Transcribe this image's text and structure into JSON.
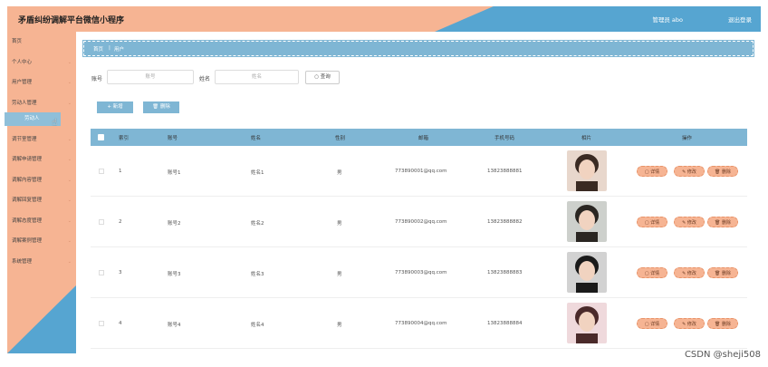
{
  "header": {
    "title": "矛盾纠纷调解平台微信小程序",
    "user": "管理员 abo",
    "logout": "退出登录"
  },
  "sidebar": {
    "items": [
      {
        "label": "首页",
        "chevron": false
      },
      {
        "label": "个人中心",
        "chevron": true
      },
      {
        "label": "用户管理",
        "chevron": true
      },
      {
        "label": "劳动人管理",
        "chevron": true
      },
      {
        "label": "调节室管理",
        "chevron": true
      },
      {
        "label": "调解申请管理",
        "chevron": true
      },
      {
        "label": "调解内容管理",
        "chevron": true
      },
      {
        "label": "调解回复管理",
        "chevron": true
      },
      {
        "label": "调解态度管理",
        "chevron": true
      },
      {
        "label": "调解案例管理",
        "chevron": true
      },
      {
        "label": "系统管理",
        "chevron": true
      }
    ],
    "submenu_item": "劳动人"
  },
  "breadcrumb": {
    "home": "首页",
    "current": "用户"
  },
  "search": {
    "account_label": "账号",
    "account_placeholder": "账号",
    "name_label": "姓名",
    "name_placeholder": "姓名",
    "button": "查询"
  },
  "actions": {
    "add": "新增",
    "delete": "删除"
  },
  "table": {
    "headers": [
      "索引",
      "账号",
      "姓名",
      "性别",
      "邮箱",
      "手机号码",
      "相片",
      "操作"
    ],
    "rows": [
      {
        "index": "1",
        "account": "账号1",
        "name": "姓名1",
        "gender": "男",
        "email": "773890001@qq.com",
        "phone": "13823888881"
      },
      {
        "index": "2",
        "account": "账号2",
        "name": "姓名2",
        "gender": "男",
        "email": "773890002@qq.com",
        "phone": "13823888882"
      },
      {
        "index": "3",
        "account": "账号3",
        "name": "姓名3",
        "gender": "男",
        "email": "773890003@qq.com",
        "phone": "13823888883"
      },
      {
        "index": "4",
        "account": "账号4",
        "name": "姓名4",
        "gender": "男",
        "email": "773890004@qq.com",
        "phone": "13823888884"
      }
    ],
    "row_actions": {
      "detail": "详情",
      "edit": "修改",
      "delete": "删除"
    }
  },
  "watermark": "CSDN @sheji508",
  "colors": {
    "peach": "#f6b493",
    "blue": "#56a5d1",
    "light_blue": "#7fb6d4"
  }
}
